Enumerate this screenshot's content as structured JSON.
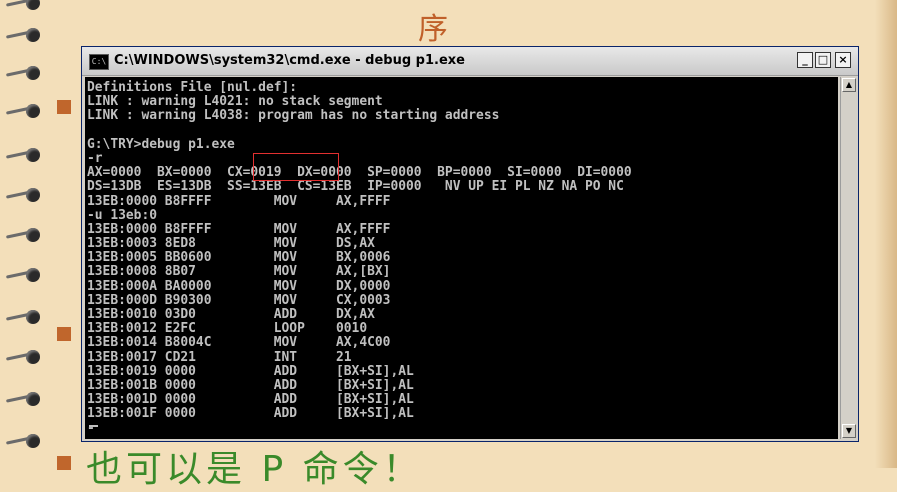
{
  "slide": {
    "title_char": "序",
    "bottom_text": "也可以是 P 命令！"
  },
  "window": {
    "title": "C:\\WINDOWS\\system32\\cmd.exe - debug p1.exe",
    "icon_label": "C:\\",
    "controls": {
      "minimize": "_",
      "maximize": "□",
      "close": "×"
    }
  },
  "console": {
    "lines": [
      "Definitions File [nul.def]:",
      "LINK : warning L4021: no stack segment",
      "LINK : warning L4038: program has no starting address",
      "",
      "G:\\TRY>debug p1.exe",
      "-r",
      "AX=0000  BX=0000  CX=0019  DX=0000  SP=0000  BP=0000  SI=0000  DI=0000",
      "DS=13DB  ES=13DB  SS=13EB  CS=13EB  IP=0000   NV UP EI PL NZ NA PO NC",
      "13EB:0000 B8FFFF        MOV     AX,FFFF",
      "-u 13eb:0",
      "13EB:0000 B8FFFF        MOV     AX,FFFF",
      "13EB:0003 8ED8          MOV     DS,AX",
      "13EB:0005 BB0600        MOV     BX,0006",
      "13EB:0008 8B07          MOV     AX,[BX]",
      "13EB:000A BA0000        MOV     DX,0000",
      "13EB:000D B90300        MOV     CX,0003",
      "13EB:0010 03D0          ADD     DX,AX",
      "13EB:0012 E2FC          LOOP    0010",
      "13EB:0014 B8004C        MOV     AX,4C00",
      "13EB:0017 CD21          INT     21",
      "13EB:0019 0000          ADD     [BX+SI],AL",
      "13EB:001B 0000          ADD     [BX+SI],AL",
      "13EB:001D 0000          ADD     [BX+SI],AL",
      "13EB:001F 0000          ADD     [BX+SI],AL",
      "-"
    ]
  },
  "colors": {
    "console_bg": "#000000",
    "console_text": "#c0c0c0",
    "highlight_box": "#e23030",
    "slide_bg": "#f3dfba",
    "bullet": "#c0662c"
  }
}
